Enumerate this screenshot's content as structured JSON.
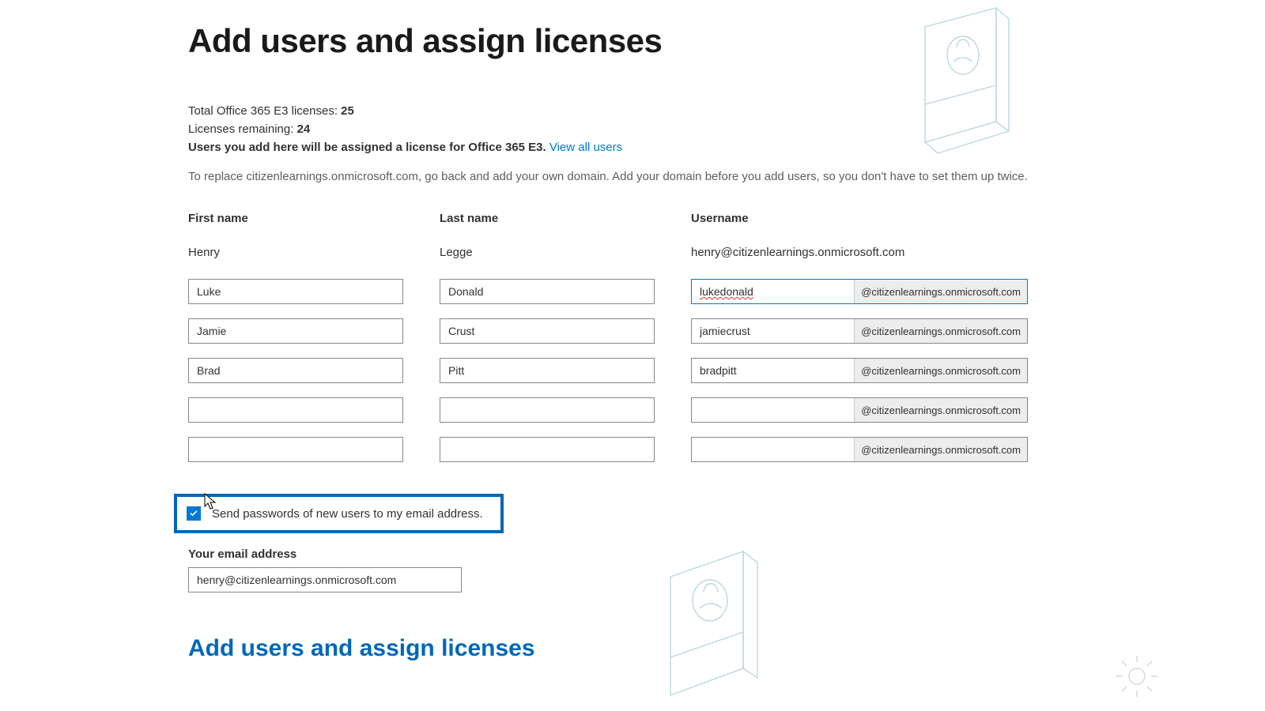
{
  "page": {
    "title": "Add users and assign licenses",
    "total_label": "Total Office 365 E3 licenses: ",
    "total_value": "25",
    "remaining_label": "Licenses remaining: ",
    "remaining_value": "24",
    "assign_note": "Users you add here will be assigned a license for Office 365 E3. ",
    "view_all_link": "View all users",
    "replace_note": "To replace citizenlearnings.onmicrosoft.com, go back and add your own domain. Add your domain before you add users, so you don't have to set them up twice."
  },
  "columns": {
    "first_name": "First name",
    "last_name": "Last name",
    "username": "Username"
  },
  "existing_user": {
    "first": "Henry",
    "last": "Legge",
    "email": "henry@citizenlearnings.onmicrosoft.com"
  },
  "domain_suffix": "@citizenlearnings.onmicrosoft.com",
  "rows": [
    {
      "first": "Luke",
      "last": "Donald",
      "user": "lukedonald",
      "focused": true,
      "spellerr": true
    },
    {
      "first": "Jamie",
      "last": "Crust",
      "user": "jamiecrust",
      "focused": false,
      "spellerr": false
    },
    {
      "first": "Brad",
      "last": "Pitt",
      "user": "bradpitt",
      "focused": false,
      "spellerr": false
    },
    {
      "first": "",
      "last": "",
      "user": "",
      "focused": false,
      "spellerr": false
    },
    {
      "first": "",
      "last": "",
      "user": "",
      "focused": false,
      "spellerr": false
    }
  ],
  "checkbox": {
    "checked": true,
    "label": "Send passwords of new users to my email address."
  },
  "email_section": {
    "label": "Your email address",
    "value": "henry@citizenlearnings.onmicrosoft.com"
  },
  "section_heading": "Add users and assign licenses"
}
